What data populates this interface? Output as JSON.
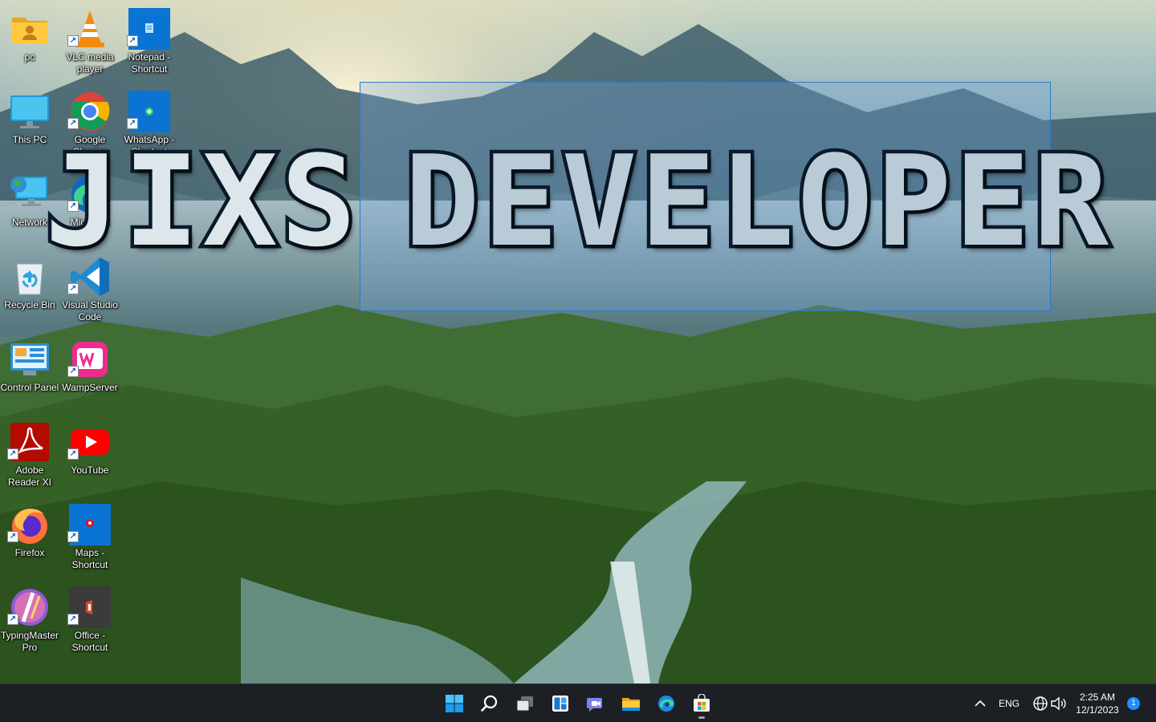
{
  "desktop": {
    "title_word1": "JIXS",
    "title_word2": "DEVELOPER",
    "icons": [
      {
        "label": "pc",
        "icon": "user-folder-icon",
        "shortcut": false
      },
      {
        "label": "VLC media player",
        "icon": "vlc-cone-icon",
        "shortcut": true
      },
      {
        "label": "Notepad - Shortcut",
        "icon": "notepad-icon",
        "shortcut": true
      },
      {
        "label": "This PC",
        "icon": "monitor-icon",
        "shortcut": false
      },
      {
        "label": "Google Chrome",
        "icon": "chrome-icon",
        "shortcut": true
      },
      {
        "label": "WhatsApp - Shortcut",
        "icon": "whatsapp-icon",
        "shortcut": true
      },
      {
        "label": "Network",
        "icon": "network-globe-icon",
        "shortcut": false
      },
      {
        "label": "Microsoft Edge",
        "icon": "edge-icon",
        "shortcut": true
      },
      {
        "label": "Recycle Bin",
        "icon": "recycle-bin-icon",
        "shortcut": false
      },
      {
        "label": "Visual Studio Code",
        "icon": "vscode-icon",
        "shortcut": true
      },
      {
        "label": "Control Panel",
        "icon": "control-panel-icon",
        "shortcut": false
      },
      {
        "label": "WampServer",
        "icon": "wampserver-icon",
        "shortcut": true
      },
      {
        "label": "Adobe Reader XI",
        "icon": "adobe-reader-icon",
        "shortcut": true
      },
      {
        "label": "YouTube",
        "icon": "youtube-icon",
        "shortcut": true
      },
      {
        "label": "Firefox",
        "icon": "firefox-icon",
        "shortcut": true
      },
      {
        "label": "Maps - Shortcut",
        "icon": "maps-icon",
        "shortcut": true
      },
      {
        "label": "TypingMaster Pro",
        "icon": "typingmaster-icon",
        "shortcut": true
      },
      {
        "label": "Office - Shortcut",
        "icon": "office-icon",
        "shortcut": true
      }
    ]
  },
  "taskbar": {
    "pinned": [
      "windows-start-icon",
      "search-icon",
      "task-view-icon",
      "widgets-icon",
      "teams-chat-icon",
      "file-explorer-icon",
      "edge-icon",
      "microsoft-store-icon"
    ],
    "tray": {
      "language": "ENG",
      "time": "2:25 AM",
      "date": "12/1/2023",
      "notifications": "1"
    }
  },
  "colors": {
    "taskbar": "#1c2024",
    "selection": "#2f78d0",
    "accent": "#0078d4"
  }
}
